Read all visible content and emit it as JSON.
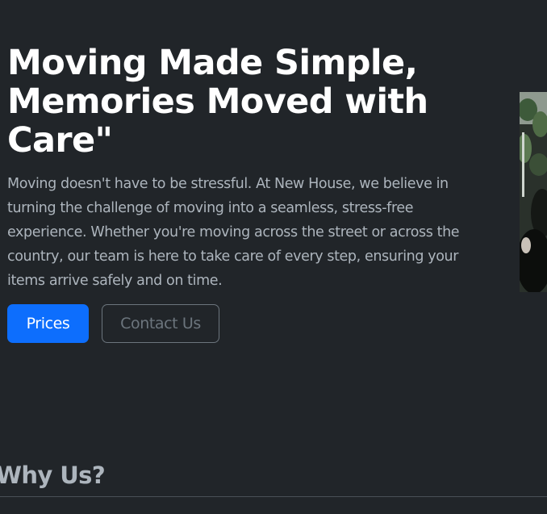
{
  "hero": {
    "title": "Moving Made Simple, Memories Moved with Care\"",
    "description": "Moving doesn't have to be stressful. At New House, we believe in turning the challenge of moving into a seamless, stress-free experience. Whether you're moving across the street or across the country, our team is here to take care of every step, ensuring your items arrive safely and on time.",
    "primary_button_label": "Prices",
    "secondary_button_label": "Contact Us"
  },
  "why_us": {
    "title": "Why Us?"
  },
  "colors": {
    "background": "#212529",
    "primary": "#0d6efd",
    "secondary": "#6c757d",
    "text_muted": "#adb5bd",
    "heading": "#ffffff"
  }
}
